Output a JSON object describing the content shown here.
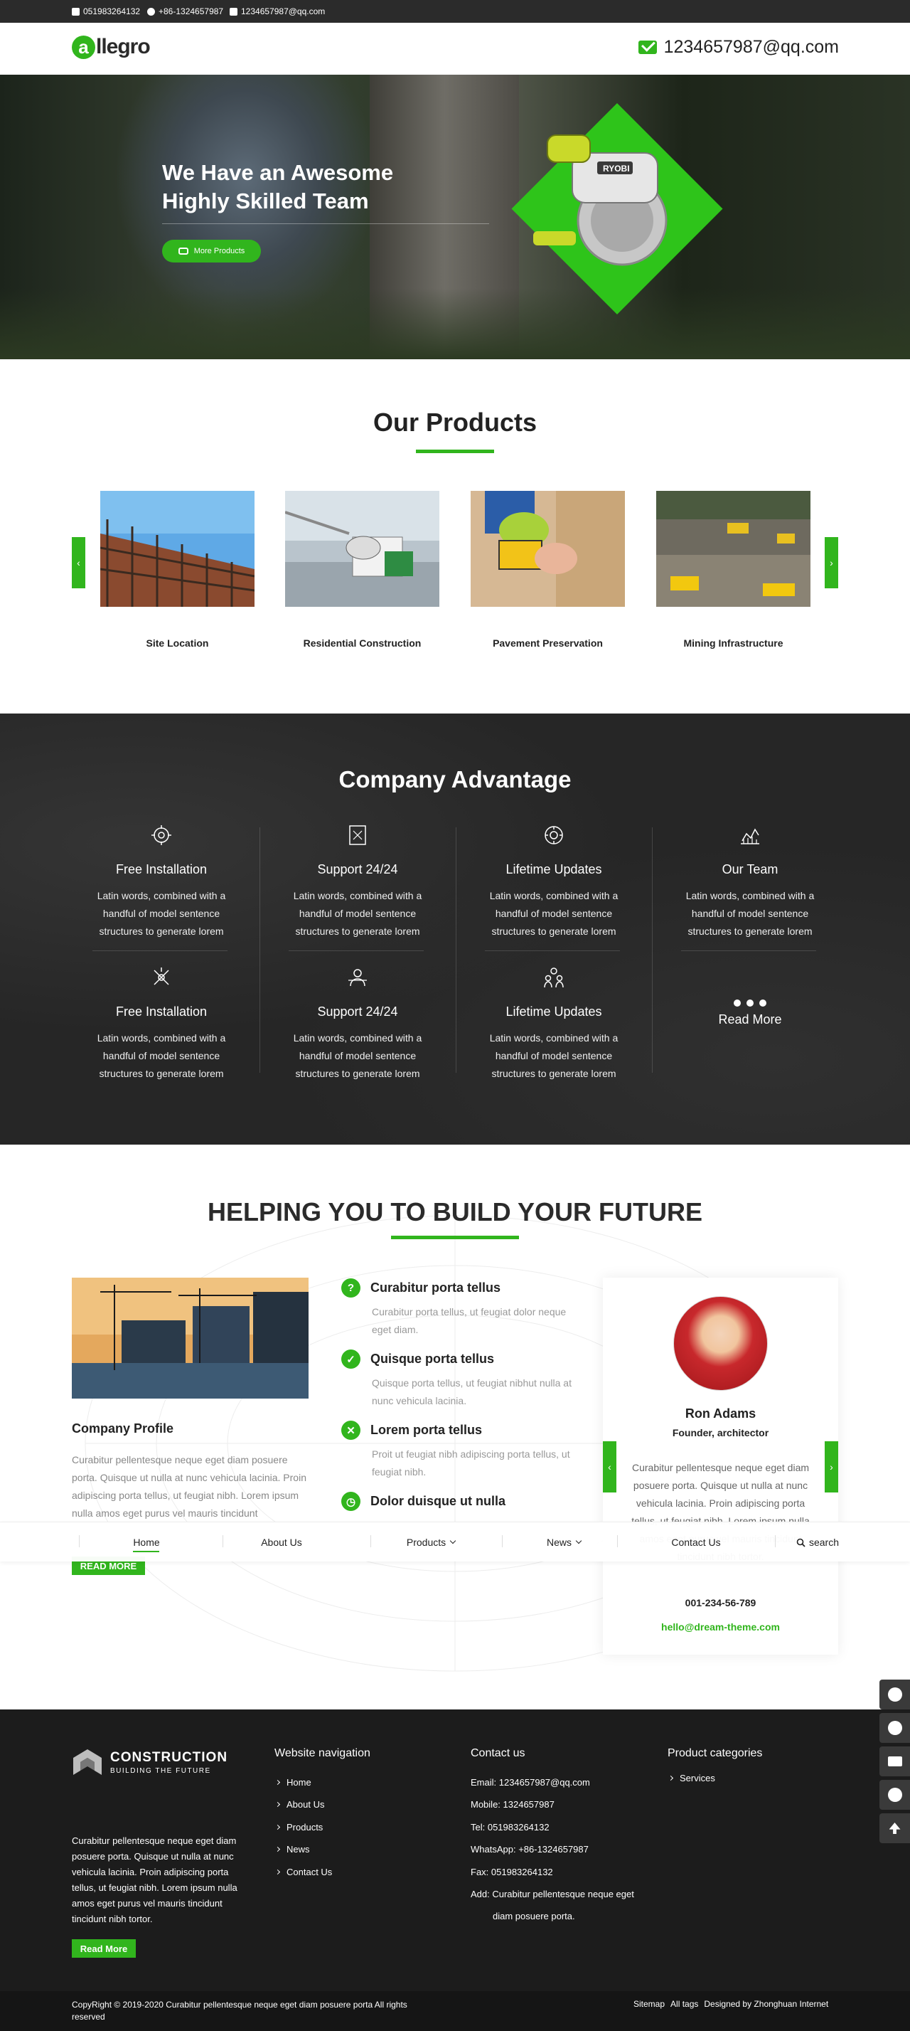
{
  "topbar": {
    "phone": "051983264132",
    "whatsapp": "+86-1324657987",
    "email": "1234657987@qq.com"
  },
  "header": {
    "logo_letter": "a",
    "logo_rest": "llegro",
    "email": "1234657987@qq.com"
  },
  "hero": {
    "title_line1": "We Have an Awesome",
    "title_line2": "Highly Skilled Team",
    "button": "More Products",
    "saw_brand": "RYOBI"
  },
  "products": {
    "title": "Our Products",
    "items": [
      {
        "name": "Site Location"
      },
      {
        "name": "Residential Construction"
      },
      {
        "name": "Pavement Preservation"
      },
      {
        "name": "Mining Infrastructure"
      }
    ]
  },
  "advantage": {
    "title": "Company Advantage",
    "items": [
      {
        "title": "Free Installation",
        "desc": "Latin words, combined with a handful of model sentence structures to generate lorem",
        "icon": "gear-icon"
      },
      {
        "title": "Support 24/24",
        "desc": "Latin words, combined with a handful of model sentence structures to generate lorem",
        "icon": "blueprint-icon"
      },
      {
        "title": "Lifetime Updates",
        "desc": "Latin words, combined with a handful of model sentence structures to generate lorem",
        "icon": "settings-icon"
      },
      {
        "title": "Our Team",
        "desc": "Latin words, combined with a handful of model sentence structures to generate lorem",
        "icon": "chart-icon"
      },
      {
        "title": "Free Installation",
        "desc": "Latin words, combined with a handful of model sentence structures to generate lorem",
        "icon": "tools-icon"
      },
      {
        "title": "Support 24/24",
        "desc": "Latin words, combined with a handful of model sentence structures to generate lorem",
        "icon": "team-icon"
      },
      {
        "title": "Lifetime Updates",
        "desc": "Latin words, combined with a handful of model sentence structures to generate lorem",
        "icon": "people-icon"
      }
    ],
    "read_more": "Read More"
  },
  "build": {
    "title": "HELPING YOU TO BUILD YOUR FUTURE",
    "profile_title": "Company Profile",
    "profile_text": "Curabitur pellentesque neque eget diam posuere porta. Quisque ut nulla at nunc vehicula lacinia. Proin adipiscing porta tellus, ut feugiat nibh. Lorem ipsum nulla amos eget purus vel mauris tincidunt",
    "read_more": "READ MORE",
    "features": [
      {
        "title": "Curabitur porta tellus",
        "text": "Curabitur porta tellus, ut feugiat dolor neque eget diam.",
        "icon": "?"
      },
      {
        "title": "Quisque porta tellus",
        "text": "Quisque porta tellus, ut feugiat nibhut nulla at nunc vehicula lacinia.",
        "icon": "✓"
      },
      {
        "title": "Lorem porta tellus",
        "text": "Proit ut feugiat nibh adipiscing porta tellus, ut feugiat nibh.",
        "icon": "✕"
      },
      {
        "title": "Dolor duisque ut nulla",
        "text": "",
        "icon": "◷"
      }
    ],
    "team": {
      "name": "Ron Adams",
      "role": "Founder, architector",
      "quote": "Curabitur pellentesque neque eget diam posuere porta. Quisque ut nulla at nunc vehicula lacinia. Proin adipiscing porta tellus, ut feugiat nibh. Lorem ipsum nulla amos eget purus vel mauris tincidunt tincidunt nibh tortor.",
      "phone": "001-234-56-789",
      "email": "hello@dream-theme.com"
    }
  },
  "nav": {
    "items": [
      "Home",
      "About Us",
      "Products",
      "News",
      "Contact Us",
      "search"
    ]
  },
  "footer": {
    "logo_title": "CONSTRUCTION",
    "logo_sub": "BUILDING THE FUTURE",
    "about": "Curabitur pellentesque neque eget diam posuere porta. Quisque ut nulla at nunc vehicula lacinia. Proin adipiscing porta tellus, ut feugiat nibh. Lorem ipsum nulla amos eget purus vel mauris tincidunt tincidunt nibh tortor.",
    "read_more": "Read More",
    "nav_title": "Website navigation",
    "nav_links": [
      "Home",
      "About Us",
      "Products",
      "News",
      "Contact Us"
    ],
    "contact_title": "Contact us",
    "contact": {
      "email": "Email: 1234657987@qq.com",
      "mobile": "Mobile: 1324657987",
      "tel": "Tel: 051983264132",
      "whatsapp": "WhatsApp: +86-1324657987",
      "fax": "Fax: 051983264132",
      "add_line1": "Add: Curabitur pellentesque neque eget",
      "add_line2": "diam posuere porta."
    },
    "cat_title": "Product categories",
    "cat_links": [
      "Services"
    ],
    "copyright_line1": "CopyRight © 2019-2020   Curabitur pellentesque neque eget diam posuere porta  All rights",
    "copyright_line2": "reserved",
    "sitemap": "Sitemap",
    "all_tags": "All tags",
    "designed": "Designed by Zhonghuan Internet"
  },
  "colors": {
    "accent": "#31b51d",
    "dark": "#262626",
    "footer": "#1c1c1c"
  }
}
